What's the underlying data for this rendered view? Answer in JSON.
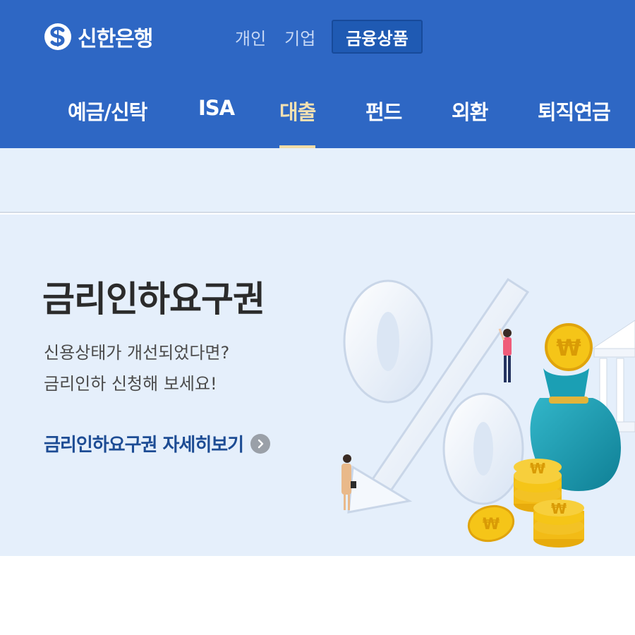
{
  "header": {
    "logo_text": "신한은행",
    "top_menu": [
      {
        "label": "개인"
      },
      {
        "label": "기업"
      },
      {
        "label": "금융상품",
        "active": true
      }
    ],
    "categories": [
      {
        "label": "예금/신탁"
      },
      {
        "label": "ISA"
      },
      {
        "label": "대출",
        "active": true
      },
      {
        "label": "펀드"
      },
      {
        "label": "외환"
      },
      {
        "label": "퇴직연금"
      }
    ]
  },
  "banner": {
    "title": "금리인하요구권",
    "subtitle_line1": "신용상태가 개선되었다면?",
    "subtitle_line2": "금리인하 신청해 보세요!",
    "link_label": "금리인하요구권 자세히보기",
    "illustration": {
      "percent_sign": "%",
      "coin_symbol": "₩"
    }
  },
  "colors": {
    "header_bg": "#2e67c4",
    "active_category": "#f3e1b2",
    "banner_bg": "#e5effb",
    "link_color": "#1d4c94",
    "coin_gold": "#f5c518",
    "money_bag": "#1aa3b8"
  },
  "icons": [
    "shinhan-logo-icon",
    "chevron-right-icon",
    "percent-illustration",
    "money-bag-icon",
    "won-coin-icon",
    "bank-building-icon"
  ]
}
